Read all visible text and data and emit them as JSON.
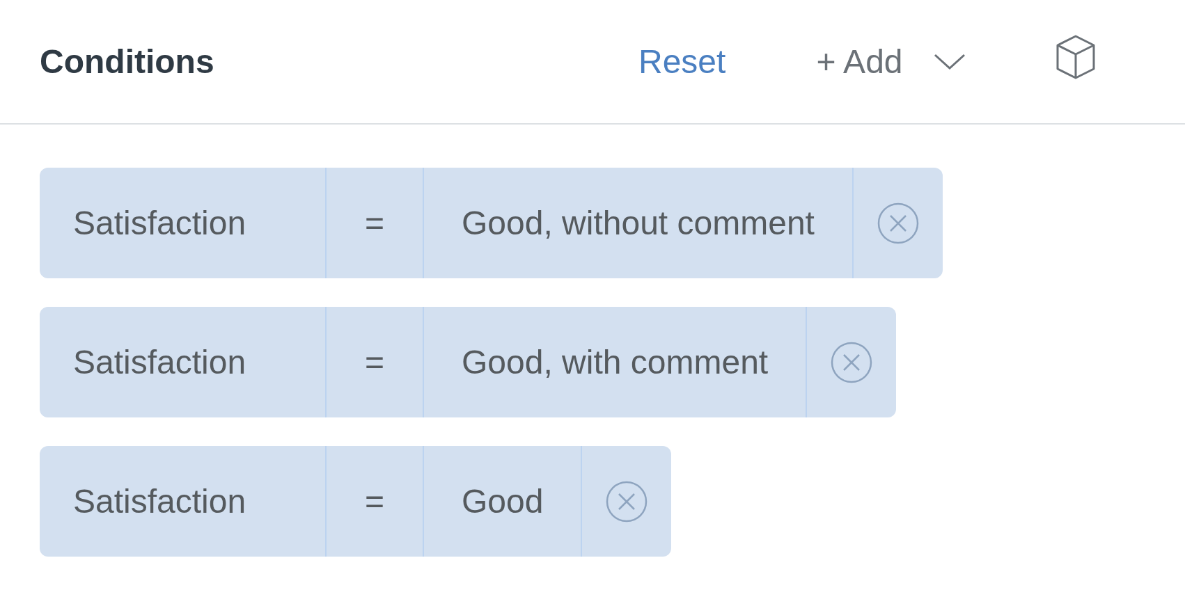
{
  "header": {
    "title": "Conditions",
    "reset_label": "Reset",
    "add_label": "+ Add"
  },
  "conditions": [
    {
      "field": "Satisfaction",
      "operator": "=",
      "value": "Good, without comment"
    },
    {
      "field": "Satisfaction",
      "operator": "=",
      "value": "Good, with comment"
    },
    {
      "field": "Satisfaction",
      "operator": "=",
      "value": "Good"
    }
  ]
}
